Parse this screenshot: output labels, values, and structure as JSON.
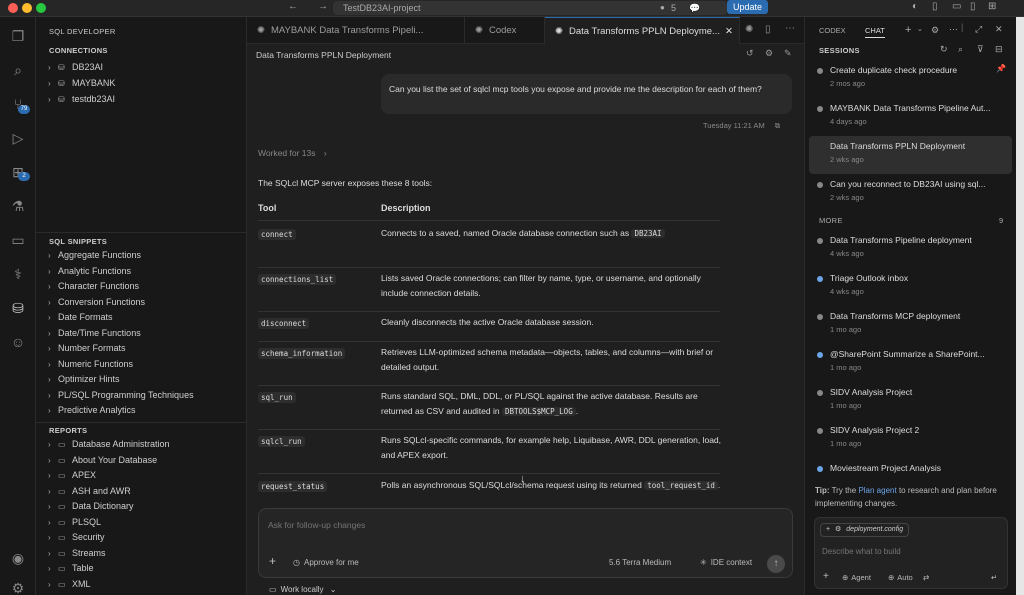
{
  "titlebar": {
    "search_text": "TestDB23AI-project",
    "notification_count": "5",
    "update_label": "Update"
  },
  "activity": {
    "scm_badge": "79",
    "ext_badge": "2"
  },
  "sidebar": {
    "title": "SQL DEVELOPER",
    "connections_header": "CONNECTIONS",
    "connections": [
      "DB23AI",
      "MAYBANK",
      "testdb23AI"
    ],
    "snippets_header": "SQL SNIPPETS",
    "snippets": [
      "Aggregate Functions",
      "Analytic Functions",
      "Character Functions",
      "Conversion Functions",
      "Date Formats",
      "Date/Time Functions",
      "Number Formats",
      "Numeric Functions",
      "Optimizer Hints",
      "PL/SQL Programming Techniques",
      "Predictive Analytics"
    ],
    "reports_header": "REPORTS",
    "reports": [
      "Database Administration",
      "About Your Database",
      "APEX",
      "ASH and AWR",
      "Data Dictionary",
      "PLSQL",
      "Security",
      "Streams",
      "Table",
      "XML"
    ]
  },
  "editor": {
    "tabs": [
      "MAYBANK Data Transforms Pipeli...",
      "Codex",
      "Data Transforms PPLN Deployme..."
    ],
    "breadcrumb": "Data Transforms PPLN Deployment",
    "user_message": "Can you list the set of sqlcl mcp tools you expose and provide me the description for each of them?",
    "timestamp": "Tuesday 11:21 AM",
    "worked_for": "Worked for 13s",
    "intro": "The SQLcl MCP server exposes these 8 tools:",
    "col_tool": "Tool",
    "col_desc": "Description",
    "tools": [
      {
        "name": "connect",
        "desc": "Connects to a saved, named Oracle database connection such as",
        "code": "DB23AI",
        "tail": ""
      },
      {
        "name": "connections_list",
        "desc": "Lists saved Oracle connections; can filter by name, type, or username, and optionally include connection details.",
        "code": "",
        "tail": ""
      },
      {
        "name": "disconnect",
        "desc": "Cleanly disconnects the active Oracle database session.",
        "code": "",
        "tail": ""
      },
      {
        "name": "schema_information",
        "desc": "Retrieves LLM-optimized schema metadata—objects, tables, and columns—with brief or detailed output.",
        "code": "",
        "tail": ""
      },
      {
        "name": "sql_run",
        "desc": "Runs standard SQL, DML, DDL, or PL/SQL against the active database. Results are returned as CSV and audited in",
        "code": "DBTOOLS$MCP_LOG",
        "tail": "."
      },
      {
        "name": "sqlcl_run",
        "desc": "Runs SQLcl-specific commands, for example help, Liquibase, AWR, DDL generation, load, and APEX export.",
        "code": "",
        "tail": ""
      },
      {
        "name": "request_status",
        "desc": "Polls an asynchronous SQL/SQLcl/schema request using its returned",
        "code": "tool_request_id",
        "tail": "."
      }
    ],
    "input_placeholder": "Ask for follow-up changes",
    "approve_label": "Approve for me",
    "model_label": "5.6 Terra  Medium",
    "ide_context_label": "IDE context",
    "work_locally_label": "Work locally"
  },
  "right_panel": {
    "tab_codex": "CODEX",
    "tab_chat": "CHAT",
    "sessions_header": "SESSIONS",
    "more_header": "MORE",
    "more_count": "9",
    "sessions": [
      {
        "title": "Create duplicate check procedure",
        "time": "2 mos ago",
        "dot": "gray"
      },
      {
        "title": "MAYBANK Data Transforms Pipeline Aut...",
        "time": "4 days ago",
        "dot": "gray"
      },
      {
        "title": "Data Transforms PPLN Deployment",
        "time": "2 wks ago",
        "dot": "none"
      },
      {
        "title": "Can you reconnect to DB23AI using sql...",
        "time": "2 wks ago",
        "dot": "gray"
      }
    ],
    "more_sessions": [
      {
        "title": "Data Transforms Pipeline deployment",
        "time": "4 wks ago",
        "dot": "gray"
      },
      {
        "title": "Triage Outlook inbox",
        "time": "4 wks ago",
        "dot": "blue"
      },
      {
        "title": "Data Transforms MCP deployment",
        "time": "1 mo ago",
        "dot": "gray"
      },
      {
        "title": "@SharePoint Summarize a SharePoint...",
        "time": "1 mo ago",
        "dot": "blue"
      },
      {
        "title": "SIDV Analysis Project",
        "time": "1 mo ago",
        "dot": "gray"
      },
      {
        "title": "SIDV Analysis Project 2",
        "time": "1 mo ago",
        "dot": "gray"
      },
      {
        "title": "Moviestream Project Analysis",
        "time": "",
        "dot": "blue"
      }
    ],
    "tip_prefix": "Tip:",
    "tip_before": "Try the",
    "tip_link": "Plan agent",
    "tip_after": "to research and plan before implementing changes.",
    "config_chip": "deployment.config",
    "describe_placeholder": "Describe what to build",
    "agent_label": "Agent",
    "auto_label": "Auto"
  }
}
